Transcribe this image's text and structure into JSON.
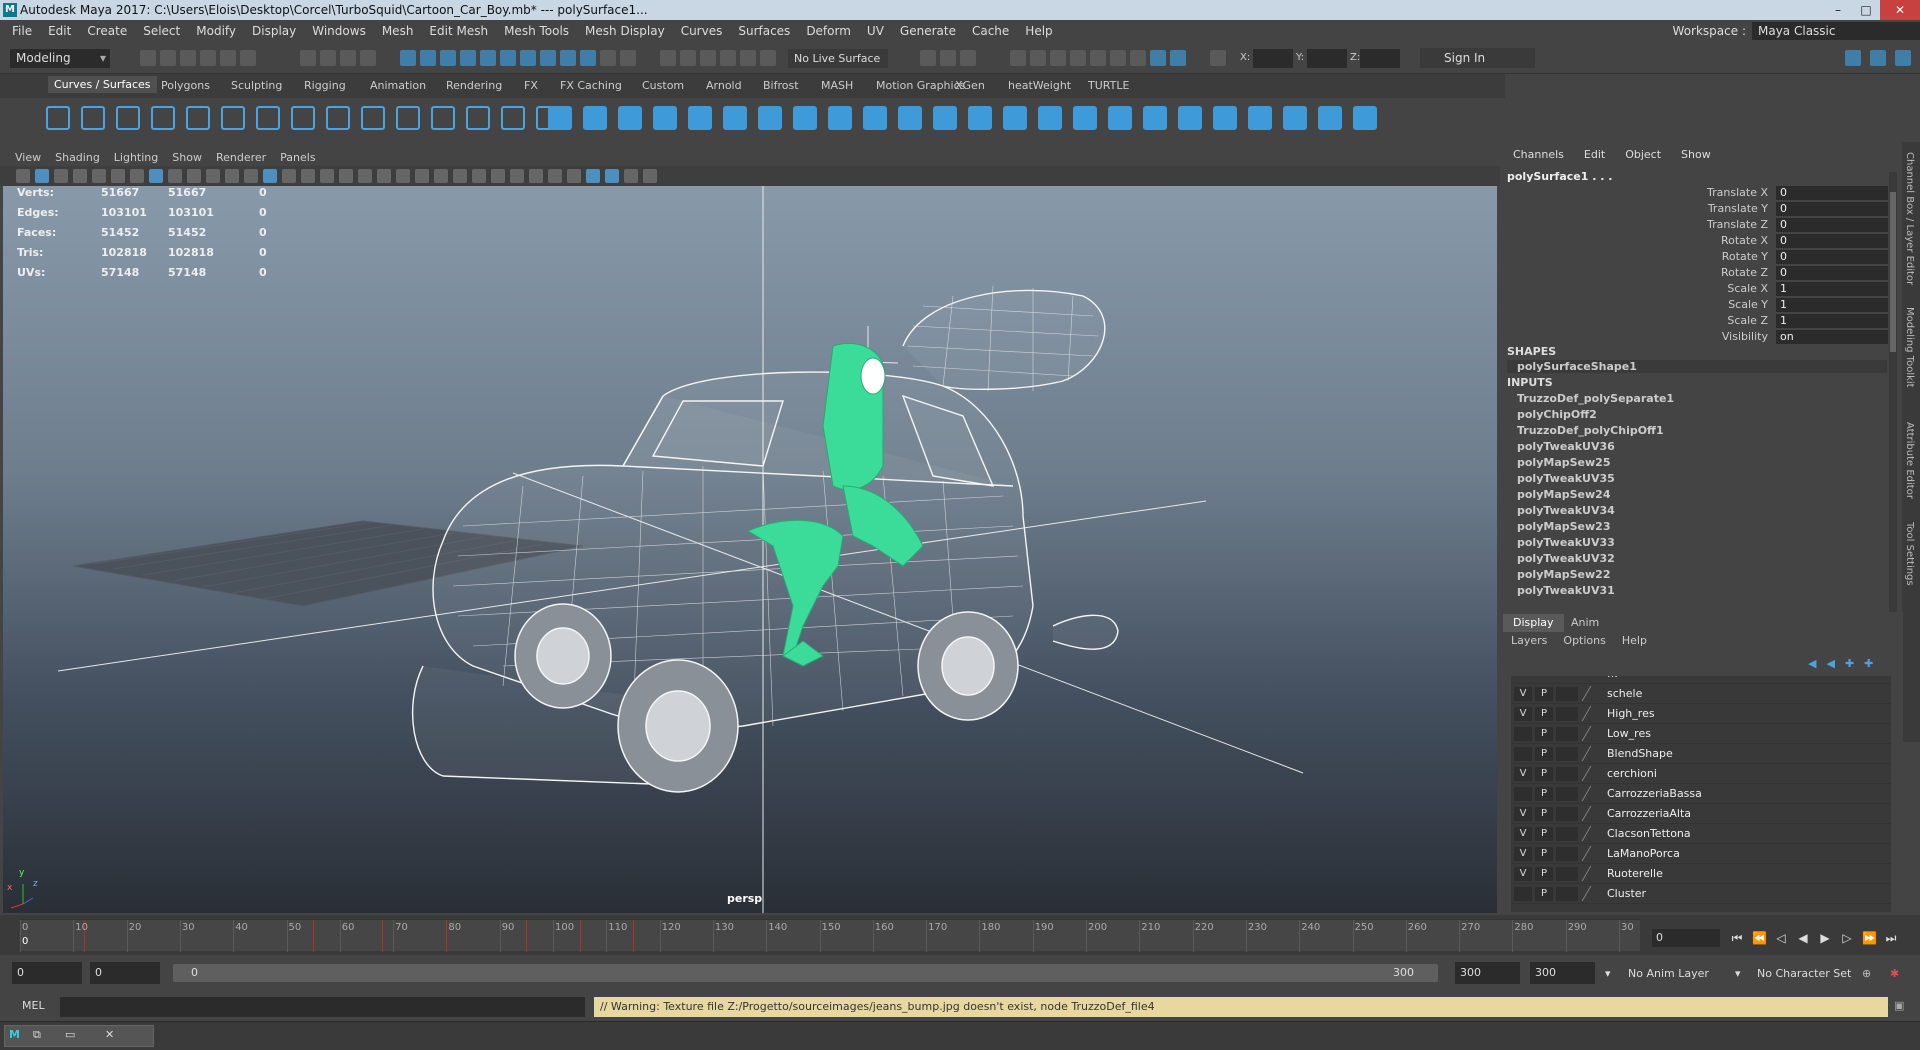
{
  "window": {
    "title": "Autodesk Maya 2017: C:\\Users\\Elois\\Desktop\\Corcel\\TurboSquid\\Cartoon_Car_Boy.mb*  ---  polySurface1...",
    "app_icon": "M"
  },
  "menubar": {
    "items": [
      "File",
      "Edit",
      "Create",
      "Select",
      "Modify",
      "Display",
      "Windows",
      "Mesh",
      "Edit Mesh",
      "Mesh Tools",
      "Mesh Display",
      "Curves",
      "Surfaces",
      "Deform",
      "UV",
      "Generate",
      "Cache",
      "Help"
    ],
    "workspace_label": "Workspace :",
    "workspace_value": "Maya Classic"
  },
  "statusline": {
    "mode": "Modeling",
    "live_surface": "No Live Surface",
    "coord_x_label": "X:",
    "coord_y_label": "Y:",
    "coord_z_label": "Z:",
    "sign_in": "Sign In"
  },
  "shelf": {
    "tabs": [
      "Curves / Surfaces",
      "Polygons",
      "Sculpting",
      "Rigging",
      "Animation",
      "Rendering",
      "FX",
      "FX Caching",
      "Custom",
      "Arnold",
      "Bifrost",
      "MASH",
      "Motion Graphics",
      "XGen",
      "heatWeight",
      "TURTLE"
    ]
  },
  "viewport": {
    "menu": [
      "View",
      "Shading",
      "Lighting",
      "Show",
      "Renderer",
      "Panels"
    ],
    "hud": [
      {
        "label": "Verts:",
        "a": "51667",
        "b": "51667",
        "c": "0"
      },
      {
        "label": "Edges:",
        "a": "103101",
        "b": "103101",
        "c": "0"
      },
      {
        "label": "Faces:",
        "a": "51452",
        "b": "51452",
        "c": "0"
      },
      {
        "label": "Tris:",
        "a": "102818",
        "b": "102818",
        "c": "0"
      },
      {
        "label": "UVs:",
        "a": "57148",
        "b": "57148",
        "c": "0"
      }
    ],
    "camera": "persp",
    "axis_y": "y",
    "axis_x": "x",
    "axis_z": "z"
  },
  "channelbox": {
    "menu": [
      "Channels",
      "Edit",
      "Object",
      "Show"
    ],
    "object": "polySurface1 . . .",
    "attributes": [
      {
        "label": "Translate X",
        "value": "0"
      },
      {
        "label": "Translate Y",
        "value": "0"
      },
      {
        "label": "Translate Z",
        "value": "0"
      },
      {
        "label": "Rotate X",
        "value": "0"
      },
      {
        "label": "Rotate Y",
        "value": "0"
      },
      {
        "label": "Rotate Z",
        "value": "0"
      },
      {
        "label": "Scale X",
        "value": "1"
      },
      {
        "label": "Scale Y",
        "value": "1"
      },
      {
        "label": "Scale Z",
        "value": "1"
      },
      {
        "label": "Visibility",
        "value": "on"
      }
    ],
    "shapes_header": "SHAPES",
    "shape": "polySurfaceShape1",
    "inputs_header": "INPUTS",
    "inputs": [
      "TruzzoDef_polySeparate1",
      "polyChipOff2",
      "TruzzoDef_polyChipOff1",
      "polyTweakUV36",
      "polyMapSew25",
      "polyTweakUV35",
      "polyMapSew24",
      "polyTweakUV34",
      "polyMapSew23",
      "polyTweakUV33",
      "polyTweakUV32",
      "polyMapSew22",
      "polyTweakUV31"
    ]
  },
  "side_tabs": [
    "Channel Box / Layer Editor",
    "Modeling Toolkit",
    "Attribute Editor",
    "Tool Settings"
  ],
  "layers": {
    "tabs": [
      "Display",
      "Anim"
    ],
    "menu": [
      "Layers",
      "Options",
      "Help"
    ],
    "partial_top": "fk",
    "rows": [
      {
        "v": "V",
        "p": "P",
        "name": "schele"
      },
      {
        "v": "V",
        "p": "P",
        "name": "High_res"
      },
      {
        "v": "",
        "p": "P",
        "name": "Low_res"
      },
      {
        "v": "",
        "p": "P",
        "name": "BlendShape"
      },
      {
        "v": "V",
        "p": "P",
        "name": "cerchioni"
      },
      {
        "v": "",
        "p": "P",
        "name": "CarrozzeriaBassa"
      },
      {
        "v": "V",
        "p": "P",
        "name": "CarrozzeriaAlta"
      },
      {
        "v": "V",
        "p": "P",
        "name": "ClacsonTettona"
      },
      {
        "v": "V",
        "p": "P",
        "name": "LaManoPorca"
      },
      {
        "v": "V",
        "p": "P",
        "name": "Ruoterelle"
      },
      {
        "v": "",
        "p": "P",
        "name": "Cluster"
      }
    ]
  },
  "timeline": {
    "ticks": [
      "0",
      "10",
      "20",
      "30",
      "40",
      "50",
      "60",
      "70",
      "80",
      "90",
      "100",
      "110",
      "120",
      "130",
      "140",
      "150",
      "160",
      "170",
      "180",
      "190",
      "200",
      "210",
      "220",
      "230",
      "240",
      "250",
      "260",
      "270",
      "280",
      "290",
      "30"
    ],
    "current_frame": "0",
    "current_marker": "0"
  },
  "range": {
    "start": "0",
    "playback_start": "0",
    "slider_left": "0",
    "slider_right": "300",
    "playback_end": "300",
    "end": "300",
    "anim_layer": "No Anim Layer",
    "character_set": "No Character Set"
  },
  "cmdline": {
    "label": "MEL",
    "warning": "// Warning: Texture file Z:/Progetto/sourceimages/jeans_bump.jpg doesn't exist, node TruzzoDef_file4"
  },
  "taskbar": {
    "item": "M"
  }
}
